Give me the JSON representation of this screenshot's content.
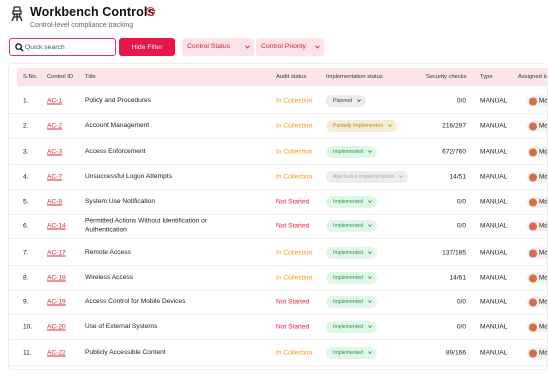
{
  "header": {
    "title": "Workbench Controls",
    "info_icon": "i",
    "subtitle": "Control-level compliance tracking"
  },
  "toolbar": {
    "search_placeholder": "Quick search",
    "hide_filter_label": "Hide Filter",
    "filters": [
      "Control Status",
      "Control Priority"
    ]
  },
  "table": {
    "headers": [
      "S.No.",
      "Control ID",
      "Title",
      "Audit status",
      "Implementation status",
      "Security checks",
      "Type",
      "Assigned ta"
    ],
    "rows": [
      {
        "sno": "1.",
        "id": "AC-1",
        "title": "Policy and Procedures",
        "audit": "In Collection",
        "impl": "Planned",
        "checks": "0/0",
        "type": "MANUAL",
        "assignee": "Md"
      },
      {
        "sno": "2.",
        "id": "AC-2",
        "title": "Account Management",
        "audit": "In Collection",
        "impl": "Partially Implemented",
        "checks": "216/297",
        "type": "MANUAL",
        "assignee": "Md"
      },
      {
        "sno": "3.",
        "id": "AC-3",
        "title": "Access Enforcement",
        "audit": "In Collection",
        "impl": "Implemented",
        "checks": "672/760",
        "type": "MANUAL",
        "assignee": "Md"
      },
      {
        "sno": "4.",
        "id": "AC-7",
        "title": "Unsuccessful Logon Attempts",
        "audit": "In Collection",
        "impl": "Alternative Implementation",
        "checks": "14/51",
        "type": "MANUAL",
        "assignee": "Md"
      },
      {
        "sno": "5.",
        "id": "AC-8",
        "title": "System Use Notification",
        "audit": "Not Started",
        "impl": "Implemented",
        "checks": "0/0",
        "type": "MANUAL",
        "assignee": "Md"
      },
      {
        "sno": "6.",
        "id": "AC-14",
        "title": "Permitted Actions Without Identification or Authentication",
        "audit": "Not Started",
        "impl": "Implemented",
        "checks": "0/0",
        "type": "MANUAL",
        "assignee": "Md"
      },
      {
        "sno": "7.",
        "id": "AC-17",
        "title": "Remote Access",
        "audit": "In Collection",
        "impl": "Implemented",
        "checks": "137/185",
        "type": "MANUAL",
        "assignee": "Md"
      },
      {
        "sno": "8.",
        "id": "AC-18",
        "title": "Wireless Access",
        "audit": "In Collection",
        "impl": "Implemented",
        "checks": "14/61",
        "type": "MANUAL",
        "assignee": "Md"
      },
      {
        "sno": "9.",
        "id": "AC-19",
        "title": "Access Control for Mobile Devices",
        "audit": "Not Started",
        "impl": "Implemented",
        "checks": "0/0",
        "type": "MANUAL",
        "assignee": "Md"
      },
      {
        "sno": "10.",
        "id": "AC-20",
        "title": "Use of External Systems",
        "audit": "Not Started",
        "impl": "Implemented",
        "checks": "0/0",
        "type": "MANUAL",
        "assignee": "Md"
      },
      {
        "sno": "11.",
        "id": "AC-22",
        "title": "Publicly Accessible Content",
        "audit": "In Collection",
        "impl": "Implemented",
        "checks": "89/166",
        "type": "MANUAL",
        "assignee": "Md"
      }
    ]
  },
  "colors": {
    "accent": "#e8164a",
    "in_collection": "#f0960a",
    "not_started": "#e8163c",
    "implemented": "#1c9a48"
  }
}
